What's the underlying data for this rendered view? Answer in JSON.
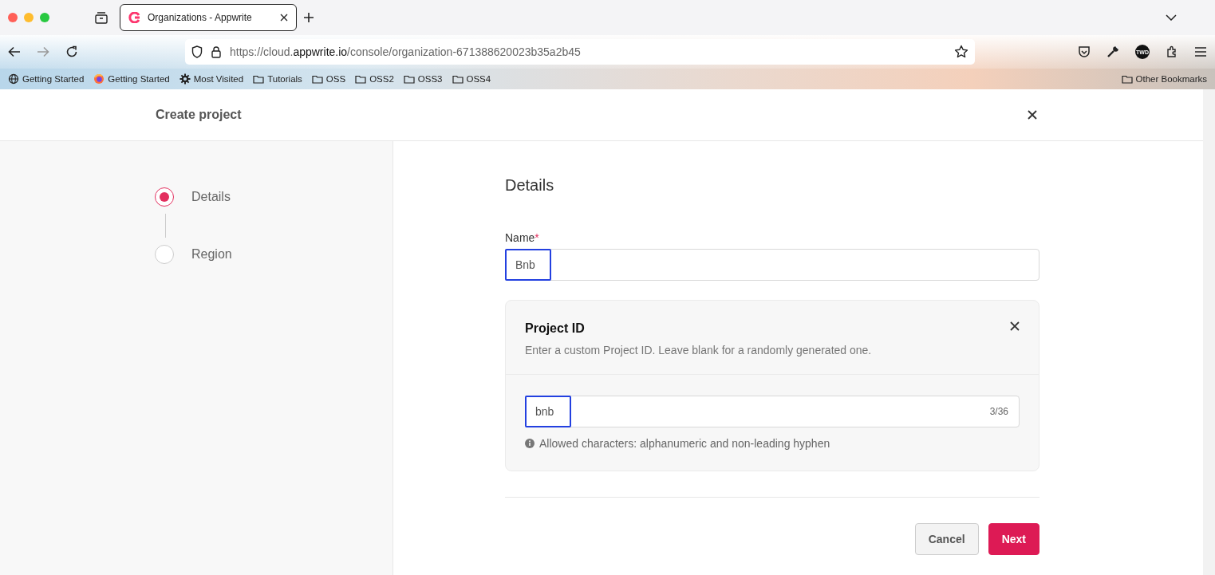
{
  "browser": {
    "tab": {
      "title": "Organizations - Appwrite",
      "selected": true
    },
    "address": {
      "prefix": "https://cloud.",
      "domain": "appwrite.io",
      "path": "/console/organization-671388620023b35a2b45"
    },
    "bookmarks": [
      {
        "kind": "globe",
        "label": "Getting Started"
      },
      {
        "kind": "firefox",
        "label": "Getting Started"
      },
      {
        "kind": "gear",
        "label": "Most Visited"
      },
      {
        "kind": "folder",
        "label": "Tutorials"
      },
      {
        "kind": "folder",
        "label": "OSS"
      },
      {
        "kind": "folder",
        "label": "OSS2"
      },
      {
        "kind": "folder",
        "label": "OSS3"
      },
      {
        "kind": "folder",
        "label": "OSS4"
      }
    ],
    "other_bookmarks": "Other Bookmarks",
    "profile_badge": "TWD"
  },
  "modal": {
    "title": "Create project",
    "steps": [
      {
        "label": "Details",
        "selected": true
      },
      {
        "label": "Region",
        "selected": false
      }
    ],
    "heading": "Details",
    "name_field": {
      "label": "Name",
      "required_mark": "*",
      "value": "Bnb"
    },
    "project_id": {
      "title": "Project ID",
      "description": "Enter a custom Project ID. Leave blank for a randomly generated one.",
      "value": "bnb",
      "counter": "3/36",
      "hint": "Allowed characters: alphanumeric and non-leading hyphen"
    },
    "buttons": [
      {
        "kind": "secondary",
        "label": "Cancel"
      },
      {
        "kind": "primary",
        "label": "Next"
      }
    ]
  }
}
